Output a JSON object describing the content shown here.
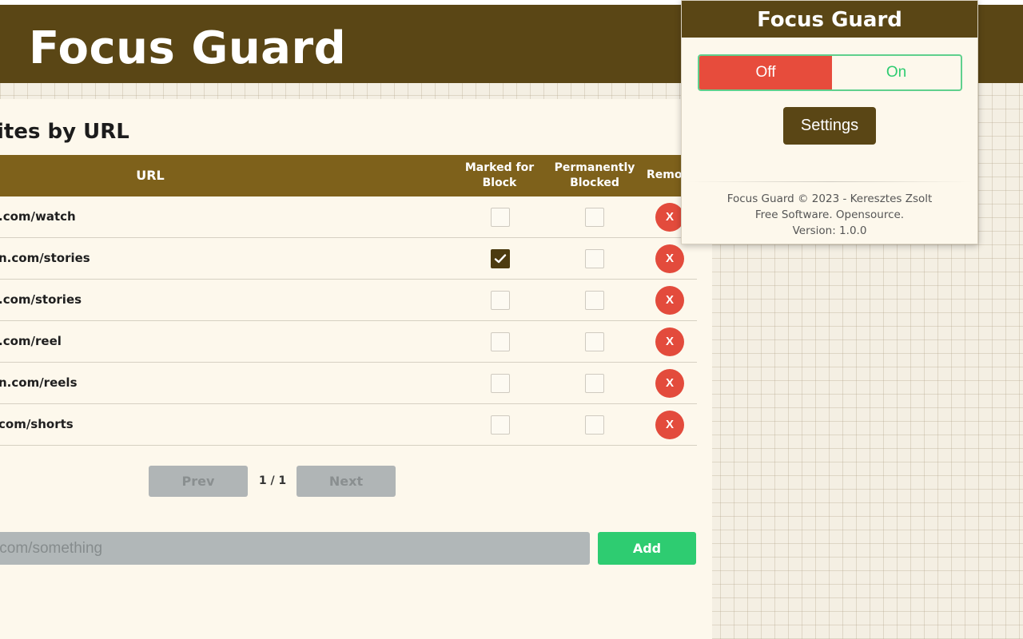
{
  "app": {
    "title": "Focus Guard",
    "section_title": "ites by URL"
  },
  "table": {
    "headers": {
      "url": "URL",
      "marked_line1": "Marked for",
      "marked_line2": "Block",
      "perm_line1": "Permanently",
      "perm_line2": "Blocked",
      "remove": "Remove"
    },
    "rows": [
      {
        "url": ".com/watch",
        "marked": false,
        "permanent": false,
        "remove_label": "X"
      },
      {
        "url": "n.com/stories",
        "marked": true,
        "permanent": false,
        "remove_label": "X"
      },
      {
        "url": ".com/stories",
        "marked": false,
        "permanent": false,
        "remove_label": "X"
      },
      {
        "url": ".com/reel",
        "marked": false,
        "permanent": false,
        "remove_label": "X"
      },
      {
        "url": "n.com/reels",
        "marked": false,
        "permanent": false,
        "remove_label": "X"
      },
      {
        "url": "com/shorts",
        "marked": false,
        "permanent": false,
        "remove_label": "X"
      }
    ]
  },
  "pagination": {
    "prev_label": "Prev",
    "next_label": "Next",
    "page_info": "1 / 1"
  },
  "add_form": {
    "placeholder": ".com/something",
    "value": "",
    "add_label": "Add"
  },
  "popup": {
    "title": "Focus Guard",
    "toggle_off_label": "Off",
    "toggle_on_label": "On",
    "toggle_state": "off",
    "settings_label": "Settings",
    "footer_line1": "Focus Guard © 2023 - Keresztes Zsolt",
    "footer_line2": "Free Software. Opensource.",
    "footer_line3": "Version: 1.0.0"
  },
  "colors": {
    "brand_dark": "#5a4615",
    "table_header": "#7e611b",
    "remove_red": "#e34b3c",
    "add_green": "#2ecc71",
    "toggle_off_red": "#e74c3c"
  },
  "icons": {
    "checkmark": "checkmark-icon"
  }
}
